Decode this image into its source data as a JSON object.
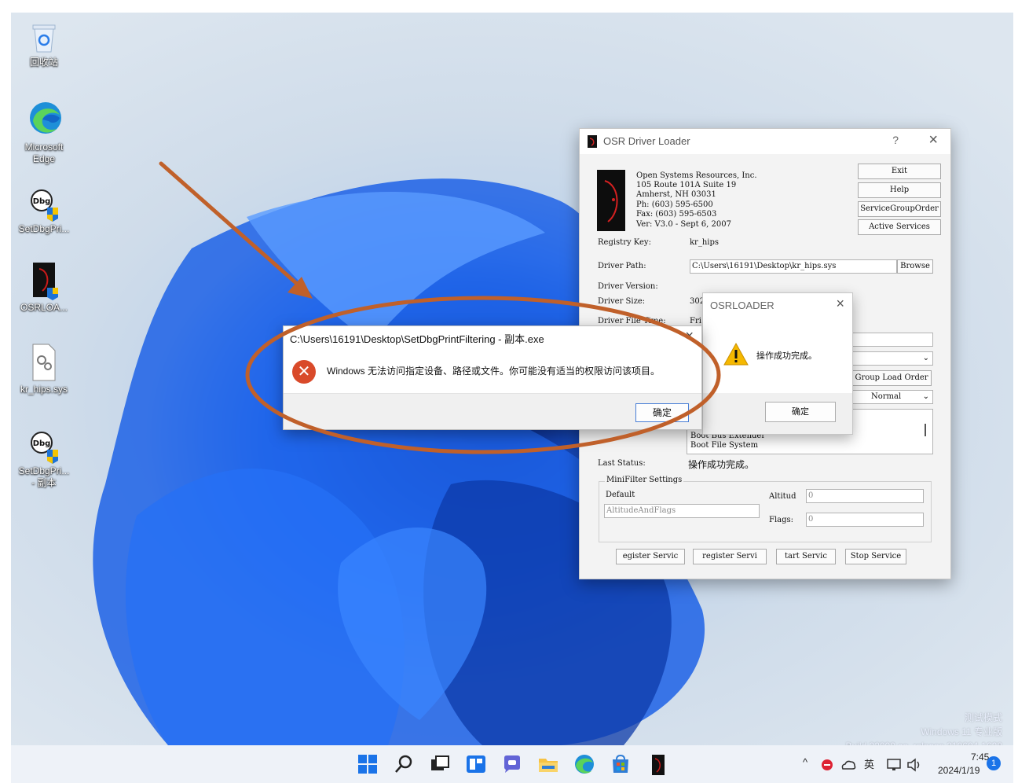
{
  "desktop": {
    "icons": [
      {
        "label": "回收站",
        "icon": "recycle-bin-icon"
      },
      {
        "label": "Microsoft Edge",
        "icon": "edge-icon"
      },
      {
        "label": "SetDbgPri...",
        "icon": "dbg-icon"
      },
      {
        "label": "OSRLOA...",
        "icon": "osrloader-icon"
      },
      {
        "label": "kr_hips.sys",
        "icon": "sys-file-icon"
      },
      {
        "label": "SetDbgPri... - 副本",
        "icon": "dbg-icon"
      }
    ]
  },
  "osr_window": {
    "title": "OSR Driver Loader",
    "help": "?",
    "company": [
      "Open Systems Resources, Inc.",
      "105 Route 101A Suite 19",
      "Amherst, NH 03031",
      "Ph:  (603) 595-6500",
      "Fax: (603) 595-6503",
      "Ver: V3.0  -  Sept 6, 2007"
    ],
    "buttons": {
      "exit": "Exit",
      "help": "Help",
      "service_group": "ServiceGroupOrder",
      "active": "Active Services",
      "browse": "Browse",
      "group_load": "Group Load Order"
    },
    "registry_key_label": "Registry Key:",
    "registry_key": "kr_hips",
    "driver_path_label": "Driver Path:",
    "driver_path": "C:\\Users\\16191\\Desktop\\kr_hips.sys",
    "driver_version_label": "Driver Version:",
    "driver_size_label": "Driver Size:",
    "driver_size_partial": "302",
    "driver_file_time_label": "Driver File Time:",
    "driver_file_time_partial": "Fri",
    "start_value": "Normal",
    "list_items": [
      "Boot Bus Extender",
      "Boot File System"
    ],
    "last_status_label": "Last Status:",
    "last_status": "操作成功完成。",
    "minifilter_label": "MiniFilter Settings",
    "default_label": "Default",
    "altitude_and_flags": "AltitudeAndFlags",
    "altitude_label": "Altitud",
    "altitude_value": "0",
    "flags_label": "Flags:",
    "flags_value": "0",
    "bottom_buttons": [
      "egister Servic",
      "register Servi",
      "tart Servic",
      "Stop Service"
    ]
  },
  "error_dialog": {
    "title": "C:\\Users\\16191\\Desktop\\SetDbgPrintFiltering - 副本.exe",
    "message": "Windows 无法访问指定设备、路径或文件。你可能没有适当的权限访问该项目。",
    "ok": "确定"
  },
  "osrloader_dialog": {
    "title": "OSRLOADER",
    "message": "操作成功完成。",
    "ok": "确定"
  },
  "taskbar": {
    "tray": {
      "chevron": "^",
      "ime": "英",
      "time": "7:45",
      "date": "2024/1/19",
      "notification_count": "1"
    }
  },
  "watermark": {
    "line1": "测试模式",
    "line2": "Windows 11 专业版",
    "line3": "Build 22000.co_release.210604-1628"
  },
  "colors": {
    "annotation": "#c0602a",
    "accent": "#1a5fe8",
    "error": "#d94a2a",
    "warning": "#f5b800"
  }
}
